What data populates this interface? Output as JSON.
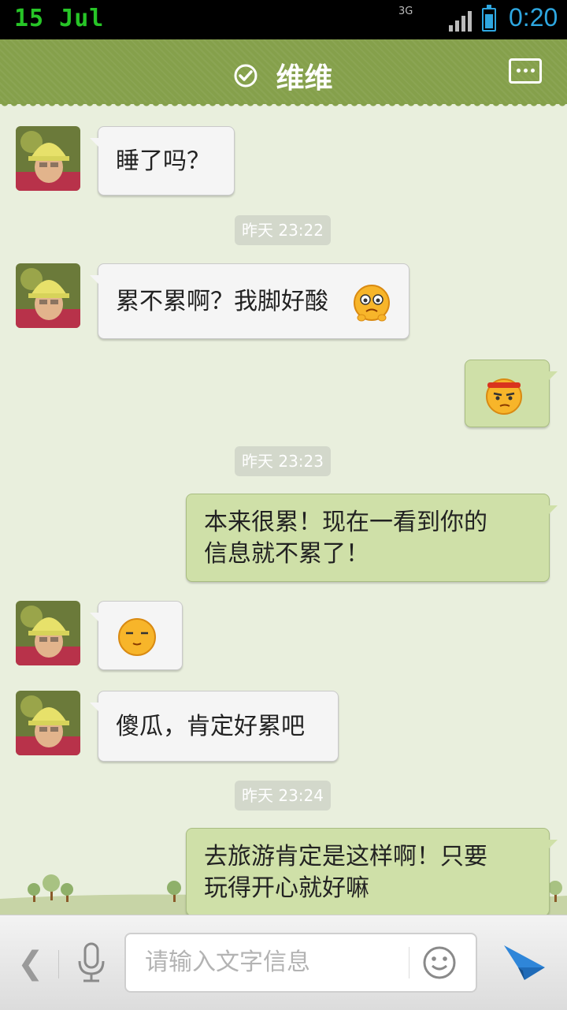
{
  "status_bar": {
    "date": "15 Jul",
    "time": "0:20",
    "network": "3G"
  },
  "header": {
    "title": "维维"
  },
  "messages": [
    {
      "side": "left",
      "text": "睡了吗？"
    },
    {
      "timestamp": "昨天 23:22"
    },
    {
      "side": "left",
      "text": "累不累啊？我脚好酸"
    },
    {
      "side": "right",
      "emoji": "angry-face-emoji"
    },
    {
      "timestamp": "昨天 23:23"
    },
    {
      "side": "right",
      "line1": "本来很累！现在一看到你的",
      "line2": "信息就不累了！"
    },
    {
      "side": "left",
      "emoji": "content-face-emoji"
    },
    {
      "side": "left",
      "text": "傻瓜，肯定好累吧"
    },
    {
      "timestamp": "昨天 23:24"
    },
    {
      "side": "right",
      "line1": "去旅游肯定是这样啊！只要",
      "line2": "玩得开心就好嘛"
    }
  ],
  "input": {
    "placeholder": "请输入文字信息"
  },
  "colors": {
    "header": "#85a04b",
    "chat_bg": "#e9efdd",
    "bubble_right": "#cfe0a8",
    "bubble_left": "#f5f5f5",
    "accent_blue": "#2ea7e0"
  }
}
